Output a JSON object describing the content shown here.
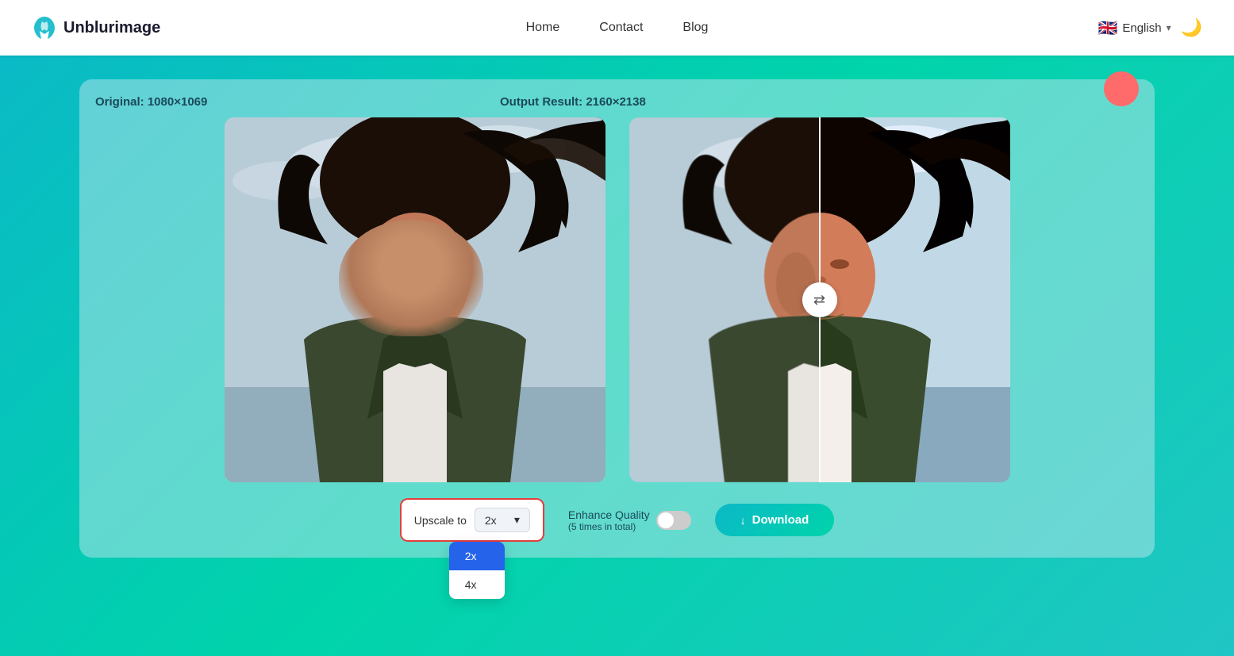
{
  "header": {
    "logo_text": "Unblurimage",
    "logo_icon": "U",
    "nav": [
      {
        "label": "Home",
        "id": "home"
      },
      {
        "label": "Contact",
        "id": "contact"
      },
      {
        "label": "Blog",
        "id": "blog"
      }
    ],
    "language": "English",
    "theme_icon": "🌙"
  },
  "main": {
    "original_label": "Original:",
    "original_dimensions": "1080×1069",
    "output_label": "Output Result:",
    "output_dimensions": "2160×2138",
    "swap_icon": "⇄",
    "upscale_label": "Upscale to",
    "upscale_current": "2x",
    "upscale_chevron": "▾",
    "dropdown_options": [
      {
        "value": "2x",
        "selected": true
      },
      {
        "value": "4x",
        "selected": false
      }
    ],
    "enhance_label": "Enhance Quality",
    "enhance_sublabel": "(5 times in total)",
    "download_label": "Download",
    "download_icon": "↓"
  }
}
